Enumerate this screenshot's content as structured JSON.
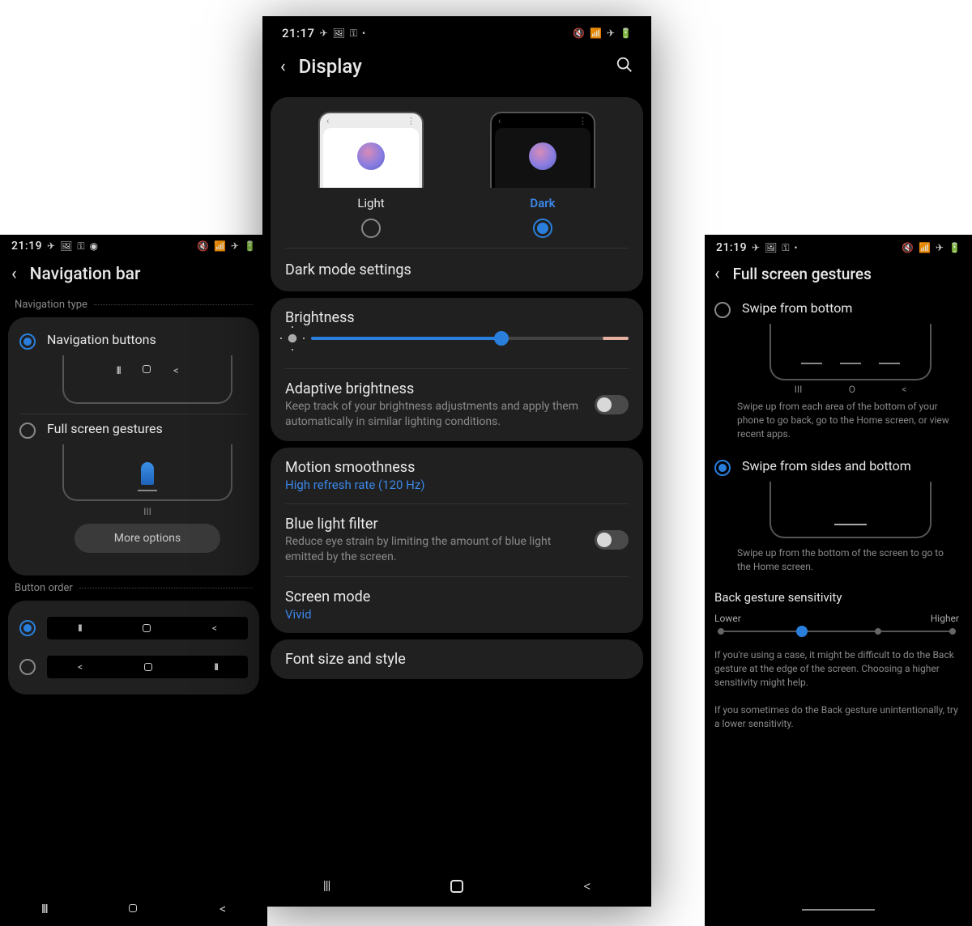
{
  "center": {
    "status": {
      "time": "21:17"
    },
    "title": "Display",
    "theme": {
      "light_label": "Light",
      "dark_label": "Dark",
      "selected": "dark"
    },
    "dark_mode_settings": "Dark mode settings",
    "brightness": {
      "title": "Brightness",
      "value_percent": 60
    },
    "adaptive": {
      "title": "Adaptive brightness",
      "desc": "Keep track of your brightness adjustments and apply them automatically in similar lighting conditions.",
      "on": false
    },
    "motion": {
      "title": "Motion smoothness",
      "value": "High refresh rate (120 Hz)"
    },
    "bluelight": {
      "title": "Blue light filter",
      "desc": "Reduce eye strain by limiting the amount of blue light emitted by the screen.",
      "on": false
    },
    "screenmode": {
      "title": "Screen mode",
      "value": "Vivid"
    },
    "font": {
      "title": "Font size and style"
    }
  },
  "left": {
    "status": {
      "time": "21:19"
    },
    "title": "Navigation bar",
    "section_nav_type": "Navigation type",
    "opt_buttons": "Navigation buttons",
    "opt_gestures": "Full screen gestures",
    "gesture_hint_label": "III",
    "more_options": "More options",
    "section_button_order": "Button order"
  },
  "right": {
    "status": {
      "time": "21:19"
    },
    "title": "Full screen gestures",
    "opt_bottom": {
      "label": "Swipe from bottom",
      "desc": "Swipe up from each area of the bottom of your phone to go back, go to the Home screen, or view recent apps."
    },
    "opt_sides": {
      "label": "Swipe from sides and bottom",
      "desc": "Swipe up from the bottom of the screen to go to the Home screen."
    },
    "sensitivity": {
      "title": "Back gesture sensitivity",
      "low": "Lower",
      "high": "Higher",
      "value_index": 1,
      "steps": 4,
      "note1": "If you're using a case, it might be difficult to do the Back gesture at the edge of the screen. Choosing a higher sensitivity might help.",
      "note2": "If you sometimes do the Back gesture unintentionally, try a lower sensitivity."
    },
    "ill_labels": {
      "recents": "III",
      "home": "O",
      "back": "<"
    }
  }
}
